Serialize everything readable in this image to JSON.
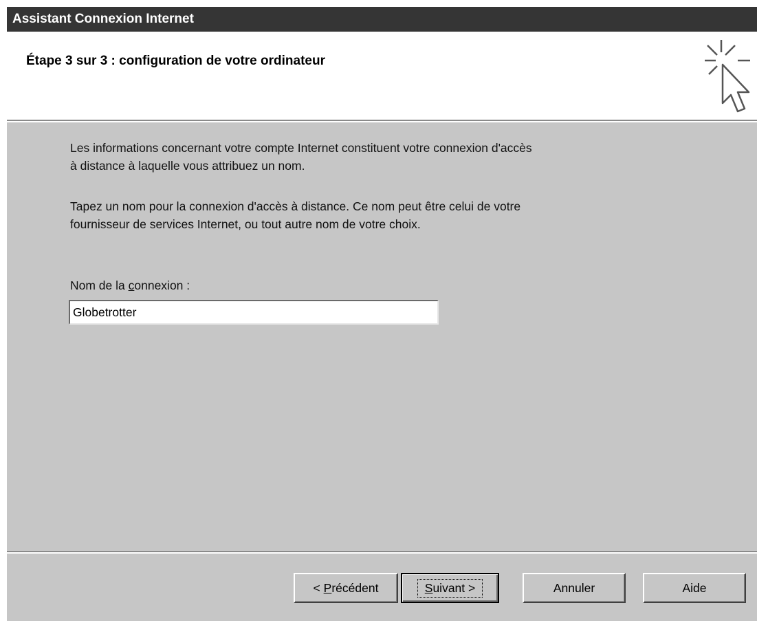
{
  "window": {
    "title": "Assistant Connexion Internet"
  },
  "header": {
    "step_title": "Étape 3 sur 3 : configuration de votre ordinateur",
    "icon": "wizard-cursor-sparkle-icon"
  },
  "content": {
    "paragraph1_line1": "Les informations concernant votre compte Internet constituent votre connexion d'accès",
    "paragraph1_line2": "à distance à laquelle vous attribuez un nom.",
    "paragraph2_line1": "Tapez un nom pour la connexion d'accès à distance. Ce nom peut être celui de votre",
    "paragraph2_line2": "fournisseur de services Internet, ou tout autre nom de votre choix.",
    "connection_label_pre": "Nom de la ",
    "connection_label_accel": "c",
    "connection_label_post": "onnexion :",
    "connection_value": "Globetrotter"
  },
  "buttons": {
    "prev_pre": "< ",
    "prev_accel": "P",
    "prev_post": "récédent",
    "next_accel": "S",
    "next_post": "uivant >",
    "cancel": "Annuler",
    "help": "Aide"
  }
}
